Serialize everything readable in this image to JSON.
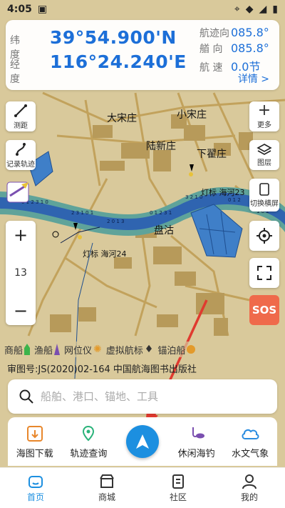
{
  "status_bar": {
    "time": "4:05"
  },
  "position": {
    "lat_label": "纬 度",
    "lat_value": "39°54.900'N",
    "lon_label": "经 度",
    "lon_value": "116°24.240'E"
  },
  "navigation": {
    "course_label": "航迹向",
    "course_value": "085.8°",
    "heading_label": "艏 向",
    "heading_value": "085.8°",
    "speed_label": "航 速",
    "speed_value": "0.0节",
    "details_link": "详情 >"
  },
  "left_tools": {
    "measure_label": "测距",
    "track_record_label": "记录轨迹"
  },
  "right_tools": {
    "more_label": "更多",
    "layers_label": "图层",
    "landscape_label": "切换横屏"
  },
  "zoom": {
    "plus": "+",
    "level": "13",
    "minus": "−"
  },
  "sos_label": "SOS",
  "map_labels": {
    "place_1": "大宋庄",
    "place_2": "小宋庄",
    "place_3": "陆新庄",
    "place_4": "下翟庄",
    "place_5": "盘沽",
    "beacon_1": "灯标 海河23",
    "beacon_2": "灯标 海河24"
  },
  "legend": {
    "items": [
      {
        "label": "商船",
        "color": "#3cb44b"
      },
      {
        "label": "渔船",
        "color": "#7a4fb0"
      },
      {
        "label": "网位仪",
        "color": "#e39a2b"
      },
      {
        "label": "虚拟航标",
        "color": "#222222"
      },
      {
        "label": "锚泊船",
        "color": "#e39a2b"
      }
    ]
  },
  "review_number": "审图号:JS(2020)02-164 中国航海图书出版社",
  "search": {
    "placeholder": "船舶、港口、锚地、工具"
  },
  "quick_tools": {
    "chart_download": "海图下载",
    "track_query": "轨迹查询",
    "leisure_fishing": "休闲海钓",
    "hydro_weather": "水文气象"
  },
  "tabs": {
    "home": "首页",
    "shop": "商城",
    "community": "社区",
    "mine": "我的"
  },
  "colors": {
    "accent": "#1c6fd8",
    "sos": "#ef6a4b",
    "water": "#3f7fc8",
    "land": "#d9c99b",
    "road": "#c7a865"
  }
}
